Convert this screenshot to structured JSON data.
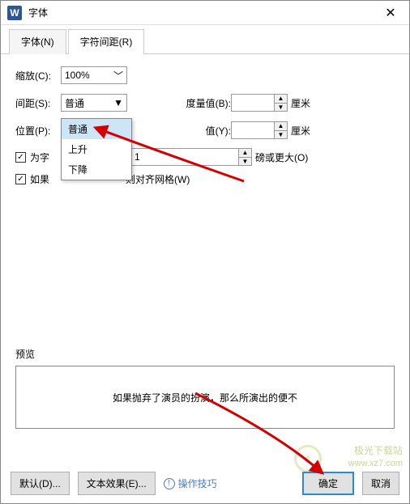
{
  "window": {
    "title": "字体"
  },
  "tabs": {
    "font": "字体(N)",
    "spacing": "字符间距(R)"
  },
  "fields": {
    "scale_label": "缩放(C):",
    "scale_value": "100%",
    "spacing_label": "间距(S):",
    "spacing_value": "普通",
    "position_label": "位置(P):",
    "measure_label": "度量值(B):",
    "measure_value": "",
    "measure_unit": "厘米",
    "value_label": "值(Y):",
    "value_value": "",
    "value_unit": "厘米",
    "kerning_cb": "为字",
    "kerning_spin": "1",
    "kerning_unit": "磅或更大(O)",
    "snap_cb": "如果",
    "snap_tail": "则对齐网格(W)"
  },
  "dropdown": {
    "opt1": "普通",
    "opt2": "上升",
    "opt3": "下降"
  },
  "preview": {
    "label": "预览",
    "text": "如果抛弃了演员的扮演，那么所演出的便不"
  },
  "buttons": {
    "default": "默认(D)...",
    "text_effects": "文本效果(E)...",
    "hint": "操作技巧",
    "ok": "确定",
    "cancel": "取消"
  },
  "watermark": {
    "line1": "极光下载站",
    "line2": "www.xz7.com"
  }
}
